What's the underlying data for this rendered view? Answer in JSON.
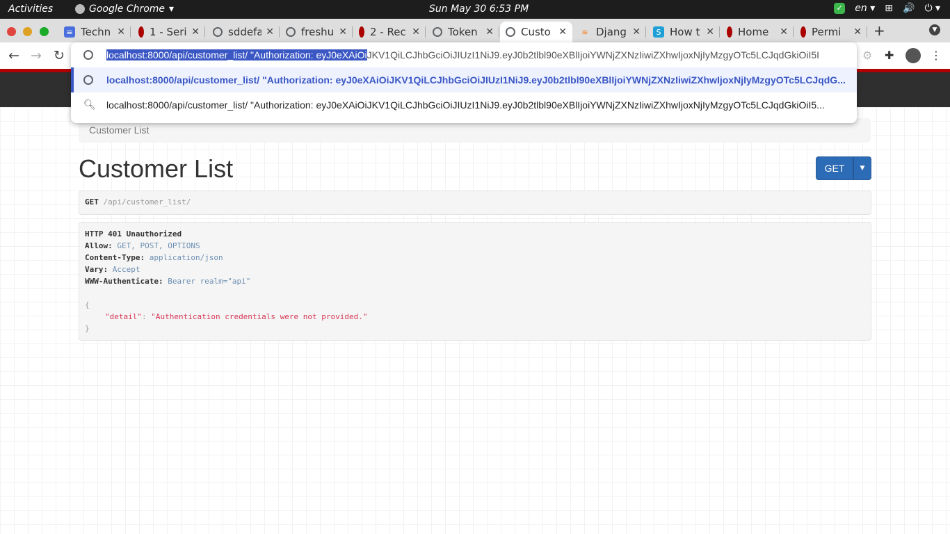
{
  "system_bar": {
    "activities": "Activities",
    "app_name": "Google Chrome",
    "clock": "Sun May 30   6:53 PM",
    "language": "en"
  },
  "tabs": [
    {
      "label": "Techn",
      "icon": "docs-icon",
      "color": "#4a6fdc"
    },
    {
      "label": "1 - Seri",
      "icon": "redis-icon",
      "color": "#a00"
    },
    {
      "label": "sddefa",
      "icon": "globe-icon",
      "color": "#5f6368"
    },
    {
      "label": "freshu",
      "icon": "globe-icon",
      "color": "#5f6368"
    },
    {
      "label": "2 - Rec",
      "icon": "redis-icon",
      "color": "#a00"
    },
    {
      "label": "Token",
      "icon": "globe-icon",
      "color": "#5f6368"
    },
    {
      "label": "Custo",
      "icon": "globe-icon",
      "color": "#5f6368",
      "active": true
    },
    {
      "label": "Djang",
      "icon": "stackoverflow-icon",
      "color": "#f48024"
    },
    {
      "label": "How t",
      "icon": "s-icon",
      "color": "#1ea0d6"
    },
    {
      "label": "Home",
      "icon": "redis-icon",
      "color": "#a00"
    },
    {
      "label": "Permi",
      "icon": "redis-icon",
      "color": "#a00"
    }
  ],
  "omnibox": {
    "selected_part": "localhost:8000/api/customer_list/  \"Authorization: eyJ0eXAiOi",
    "unselected_part": "JKV1QiLCJhbGciOiJIUzI1NiJ9.eyJ0b2tlbl90eXBlIjoiYWNjZXNzIiwiZXhwIjoxNjIyMzgyOTc5LCJqdGkiOiI5I",
    "suggestion_url": "localhost:8000/api/customer_list/  \"Authorization: eyJ0eXAiOiJKV1QiLCJhbGciOiJIUzI1NiJ9.eyJ0b2tlbl90eXBlIjoiYWNjZXNzIiwiZXhwIjoxNjIyMzgyOTc5LCJqdG...",
    "suggestion_search": "localhost:8000/api/customer_list/ \"Authorization: eyJ0eXAiOiJKV1QiLCJhbGciOiJIUzI1NiJ9.eyJ0b2tlbl90eXBlIjoiYWNjZXNzIiwiZXhwIjoxNjIyMzgyOTc5LCJqdGkiOiI5..."
  },
  "page": {
    "breadcrumb": "Customer List",
    "title": "Customer List",
    "get_button": "GET",
    "request_method": "GET",
    "request_path": "/api/customer_list/",
    "response": {
      "status": "HTTP 401 Unauthorized",
      "allow_label": "Allow:",
      "allow_value": "GET, POST, OPTIONS",
      "content_type_label": "Content-Type:",
      "content_type_value": "application/json",
      "vary_label": "Vary:",
      "vary_value": "Accept",
      "www_auth_label": "WWW-Authenticate:",
      "www_auth_value": "Bearer realm=\"api\"",
      "open_brace": "{",
      "detail_key": "\"detail\"",
      "detail_value": "\"Authentication credentials were not provided.\"",
      "close_brace": "}"
    }
  },
  "colors": {
    "accent": "#2c6bb5",
    "omnibox_selection": "#3a57c4",
    "header_band": "#2f2f2f",
    "red_line": "#b00000"
  }
}
